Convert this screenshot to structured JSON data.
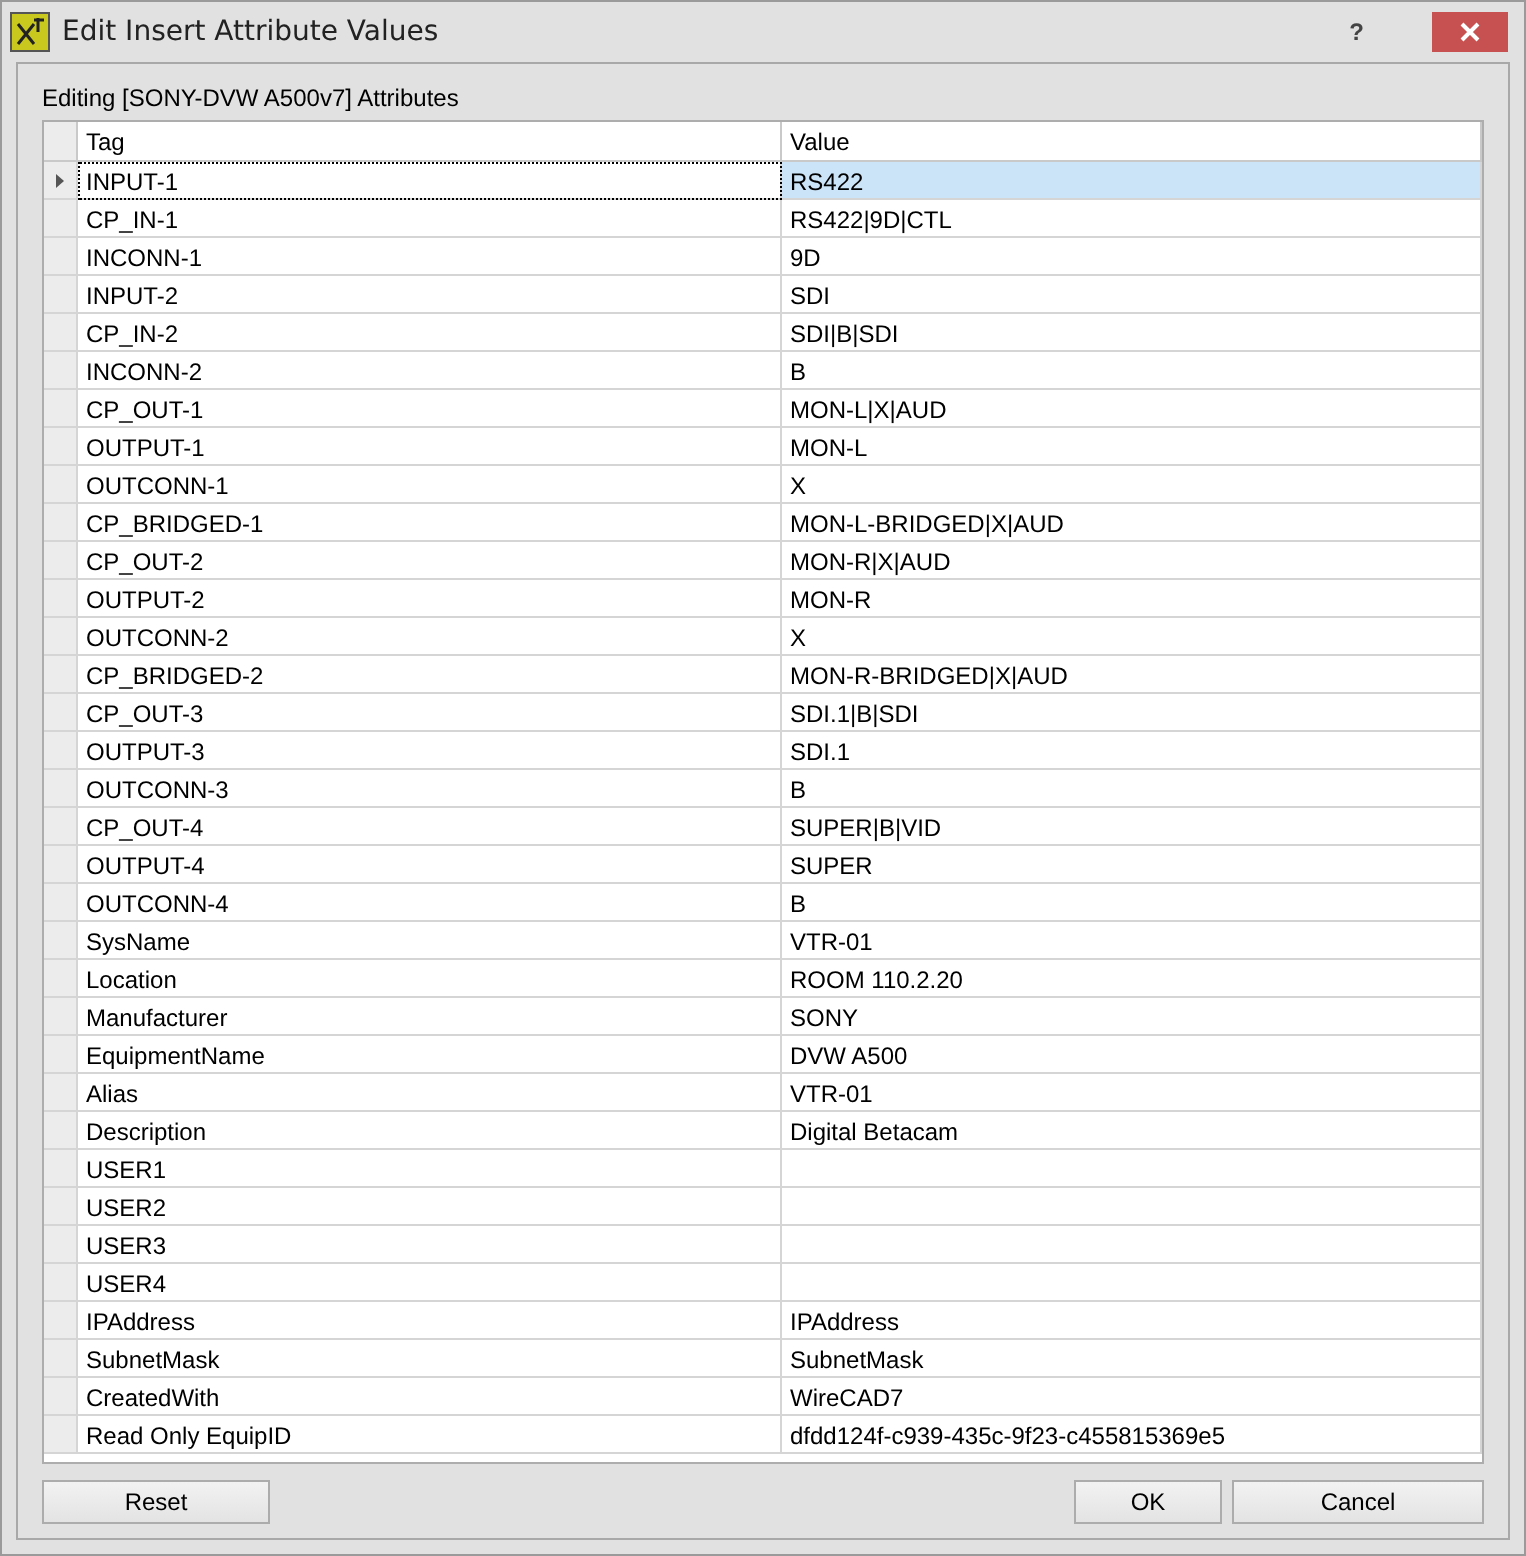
{
  "window": {
    "title": "Edit Insert Attribute Values",
    "help": "?"
  },
  "caption": "Editing [SONY-DVW A500v7] Attributes",
  "table": {
    "columns": [
      "Tag",
      "Value"
    ],
    "rows": [
      {
        "tag": "INPUT-1",
        "value": "RS422",
        "selected": true
      },
      {
        "tag": "CP_IN-1",
        "value": "RS422|9D|CTL",
        "selected": false
      },
      {
        "tag": "INCONN-1",
        "value": "9D",
        "selected": false
      },
      {
        "tag": "INPUT-2",
        "value": "SDI",
        "selected": false
      },
      {
        "tag": "CP_IN-2",
        "value": "SDI|B|SDI",
        "selected": false
      },
      {
        "tag": "INCONN-2",
        "value": "B",
        "selected": false
      },
      {
        "tag": "CP_OUT-1",
        "value": "MON-L|X|AUD",
        "selected": false
      },
      {
        "tag": "OUTPUT-1",
        "value": "MON-L",
        "selected": false
      },
      {
        "tag": "OUTCONN-1",
        "value": "X",
        "selected": false
      },
      {
        "tag": "CP_BRIDGED-1",
        "value": "MON-L-BRIDGED|X|AUD",
        "selected": false
      },
      {
        "tag": "CP_OUT-2",
        "value": "MON-R|X|AUD",
        "selected": false
      },
      {
        "tag": "OUTPUT-2",
        "value": "MON-R",
        "selected": false
      },
      {
        "tag": "OUTCONN-2",
        "value": "X",
        "selected": false
      },
      {
        "tag": "CP_BRIDGED-2",
        "value": "MON-R-BRIDGED|X|AUD",
        "selected": false
      },
      {
        "tag": "CP_OUT-3",
        "value": "SDI.1|B|SDI",
        "selected": false
      },
      {
        "tag": "OUTPUT-3",
        "value": "SDI.1",
        "selected": false
      },
      {
        "tag": "OUTCONN-3",
        "value": "B",
        "selected": false
      },
      {
        "tag": "CP_OUT-4",
        "value": "SUPER|B|VID",
        "selected": false
      },
      {
        "tag": "OUTPUT-4",
        "value": "SUPER",
        "selected": false
      },
      {
        "tag": "OUTCONN-4",
        "value": "B",
        "selected": false
      },
      {
        "tag": "SysName",
        "value": "VTR-01",
        "selected": false
      },
      {
        "tag": "Location",
        "value": "ROOM 110.2.20",
        "selected": false
      },
      {
        "tag": "Manufacturer",
        "value": "SONY",
        "selected": false
      },
      {
        "tag": "EquipmentName",
        "value": "DVW A500",
        "selected": false
      },
      {
        "tag": "Alias",
        "value": "VTR-01",
        "selected": false
      },
      {
        "tag": "Description",
        "value": "Digital Betacam",
        "selected": false
      },
      {
        "tag": "USER1",
        "selected": false
      },
      {
        "tag": "USER2",
        "selected": false
      },
      {
        "tag": "USER3",
        "selected": false
      },
      {
        "tag": "USER4",
        "selected": false
      },
      {
        "tag": "IPAddress",
        "value": "IPAddress",
        "selected": false
      },
      {
        "tag": "SubnetMask",
        "value": "SubnetMask",
        "selected": false
      },
      {
        "tag": "CreatedWith",
        "value": "WireCAD7",
        "selected": false
      },
      {
        "tag": "Read Only EquipID",
        "value": "dfdd124f-c939-435c-9f23-c455815369e5",
        "selected": false
      }
    ]
  },
  "buttons": {
    "left": [
      "Reset"
    ],
    "right": [
      "OK",
      "Cancel"
    ]
  }
}
